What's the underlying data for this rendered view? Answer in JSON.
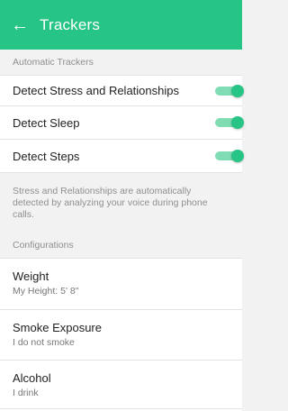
{
  "header": {
    "back_icon": "arrow-left-icon",
    "title": "Trackers",
    "color": "#26c485"
  },
  "automatic": {
    "section_title": "Automatic Trackers",
    "items": [
      {
        "label": "Detect Stress and Relationships",
        "enabled": true
      },
      {
        "label": "Detect Sleep",
        "enabled": true
      },
      {
        "label": "Detect Steps",
        "enabled": true
      }
    ],
    "info_text": "Stress and Relationships are automatically detected by analyzing your voice during phone calls."
  },
  "configurations": {
    "section_title": "Configurations",
    "items": [
      {
        "title": "Weight",
        "subtitle": "My Height: 5' 8\""
      },
      {
        "title": "Smoke Exposure",
        "subtitle": "I do not smoke"
      },
      {
        "title": "Alcohol",
        "subtitle": "I drink"
      }
    ]
  }
}
